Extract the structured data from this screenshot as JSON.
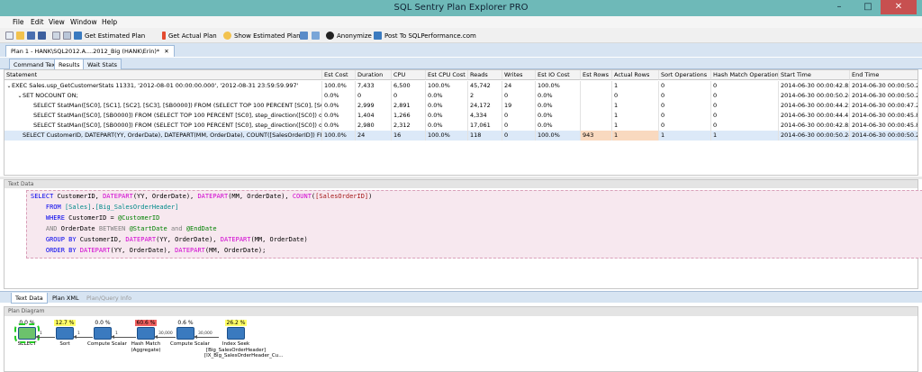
{
  "window": {
    "title": "SQL Sentry Plan Explorer PRO",
    "min_glyph": "–",
    "max_glyph": "□",
    "close_glyph": "✕"
  },
  "menu": [
    "File",
    "Edit",
    "View",
    "Window",
    "Help"
  ],
  "toolbar": {
    "get_estimated_plan": "Get Estimated Plan",
    "get_actual_plan": "Get Actual Plan",
    "show_estimated_plan": "Show Estimated Plan",
    "anonymize": "Anonymize",
    "post_to": "Post To SQLPerformance.com"
  },
  "doc_tab": {
    "label": "Plan 1 - HANK\\SQL2012.A....2012_Big (HANK\\Erin)*",
    "close": "✕"
  },
  "sub_tabs": [
    "Command Text",
    "Results",
    "Wait Stats"
  ],
  "grid": {
    "columns": [
      "Statement",
      "Est Cost",
      "Duration",
      "CPU",
      "Est CPU Cost",
      "Reads",
      "Writes",
      "Est IO Cost",
      "Est Rows",
      "Actual Rows",
      "Sort Operations",
      "Hash Match Operations",
      "Start Time",
      "End Time"
    ],
    "rows": [
      {
        "twisty": "⌄",
        "indent": 0,
        "cells": [
          "EXEC Sales.usp_GetCustomerStats 11331, '2012-08-01 00:00:00.000', '2012-08-31 23:59:59.997'",
          "100.0%",
          "7,433",
          "6,500",
          "100.0%",
          "45,742",
          "24",
          "100.0%",
          "",
          "1",
          "0",
          "0",
          "2014-06-30 00:00:42.830",
          "2014-06-30 00:00:50.263"
        ]
      },
      {
        "twisty": "⌄",
        "indent": 1,
        "cells": [
          "SET NOCOUNT ON;",
          "0.0%",
          "0",
          "0",
          "0.0%",
          "2",
          "0",
          "0.0%",
          "",
          "0",
          "0",
          "0",
          "2014-06-30 00:00:50.240",
          "2014-06-30 00:00:50.240"
        ]
      },
      {
        "twisty": "",
        "indent": 2,
        "cells": [
          "SELECT StatMan([SC0], [SC1], [SC2], [SC3], [SB0000]) FROM (SELECT TOP 100 PERCENT [SC0], [SC1], [SC...",
          "0.0%",
          "2,999",
          "2,891",
          "0.0%",
          "24,172",
          "19",
          "0.0%",
          "",
          "1",
          "0",
          "0",
          "2014-06-30 00:00:44.230",
          "2014-06-30 00:00:47.230"
        ]
      },
      {
        "twisty": "",
        "indent": 2,
        "cells": [
          "SELECT StatMan([SC0], [SB0000]) FROM (SELECT TOP 100 PERCENT [SC0], step_direction([SC0]) over (ord...",
          "0.0%",
          "1,404",
          "1,266",
          "0.0%",
          "4,334",
          "0",
          "0.0%",
          "",
          "1",
          "0",
          "0",
          "2014-06-30 00:00:44.416",
          "2014-06-30 00:00:45.820"
        ]
      },
      {
        "twisty": "",
        "indent": 2,
        "cells": [
          "SELECT StatMan([SC0], [SB0000]) FROM (SELECT TOP 100 PERCENT [SC0], step_direction([SC0]) over (ord...",
          "0.0%",
          "2,980",
          "2,312",
          "0.0%",
          "17,061",
          "0",
          "0.0%",
          "",
          "1",
          "0",
          "0",
          "2014-06-30 00:00:42.833",
          "2014-06-30 00:00:45.813"
        ]
      },
      {
        "twisty": "",
        "indent": 1,
        "selected": true,
        "cells": [
          "SELECT CustomerID, DATEPART(YY, OrderDate), DATEPART(MM, OrderDate), COUNT([SalesOrderID]) FROM [... ",
          "100.0%",
          "24",
          "16",
          "100.0%",
          "118",
          "0",
          "100.0%",
          "943",
          "1",
          "1",
          "1",
          "2014-06-30 00:00:50.240",
          "2014-06-30 00:00:50.263"
        ]
      }
    ]
  },
  "text_panel": {
    "header": "Text Data",
    "code": [
      [
        [
          "kw",
          "SELECT "
        ],
        [
          "",
          "CustomerID, "
        ],
        [
          "fn",
          "DATEPART"
        ],
        [
          "",
          "(YY, OrderDate), "
        ],
        [
          "fn",
          "DATEPART"
        ],
        [
          "",
          "(MM, OrderDate), "
        ],
        [
          "fn",
          "COUNT"
        ],
        [
          "",
          "("
        ],
        [
          "br",
          "[SalesOrderID]"
        ],
        [
          "",
          ")"
        ]
      ],
      [
        [
          "",
          "    "
        ],
        [
          "kw",
          "FROM "
        ],
        [
          "ob",
          "[Sales]"
        ],
        [
          "",
          "."
        ],
        [
          "ob",
          "[Big_SalesOrderHeader]"
        ]
      ],
      [
        [
          "",
          "    "
        ],
        [
          "kw",
          "WHERE "
        ],
        [
          "",
          "CustomerID = "
        ],
        [
          "vr",
          "@CustomerID"
        ]
      ],
      [
        [
          "",
          "    "
        ],
        [
          "gy",
          "AND "
        ],
        [
          "",
          "OrderDate "
        ],
        [
          "gy",
          "BETWEEN "
        ],
        [
          "vr",
          "@StartDate"
        ],
        [
          "gy",
          " and "
        ],
        [
          "vr",
          "@EndDate"
        ]
      ],
      [
        [
          "",
          "    "
        ],
        [
          "kw",
          "GROUP BY "
        ],
        [
          "",
          "CustomerID, "
        ],
        [
          "fn",
          "DATEPART"
        ],
        [
          "",
          "(YY, OrderDate), "
        ],
        [
          "fn",
          "DATEPART"
        ],
        [
          "",
          "(MM, OrderDate)"
        ]
      ],
      [
        [
          "",
          "    "
        ],
        [
          "kw",
          "ORDER BY "
        ],
        [
          "fn",
          "DATEPART"
        ],
        [
          "",
          "(YY, OrderDate), "
        ],
        [
          "fn",
          "DATEPART"
        ],
        [
          "",
          "(MM, OrderDate);"
        ]
      ]
    ]
  },
  "bottom_tabs": [
    "Text Data",
    "Plan XML",
    "Plan/Query Info"
  ],
  "plan_diagram": {
    "header": "Plan Diagram",
    "nodes": [
      {
        "pct": "0.0 %",
        "pct_color": "#ffffff",
        "name": "SELECT",
        "icon_color": "#6cc26c"
      },
      {
        "pct": "12.7 %",
        "pct_color": "#ffff66",
        "name": "Sort",
        "icon_color": "#3a7abf"
      },
      {
        "pct": "0.0 %",
        "pct_color": "#ffffff",
        "name": "Compute Scalar",
        "icon_color": "#3a7abf"
      },
      {
        "pct": "60.6 %",
        "pct_color": "#f06060",
        "name": "Hash Match\n(Aggregate)",
        "icon_color": "#3a7abf"
      },
      {
        "pct": "0.6 %",
        "pct_color": "#ffffff",
        "name": "Compute Scalar",
        "icon_color": "#3a7abf"
      },
      {
        "pct": "26.2 %",
        "pct_color": "#ffff66",
        "name": "Index Seek\n[Big_SalesOrderHeader]\n[IX_Big_SalesOrderHeader_Cu...",
        "icon_color": "#3a7abf"
      }
    ],
    "row_counts": [
      "1",
      "1",
      "1",
      "30,000",
      "30,000"
    ]
  }
}
